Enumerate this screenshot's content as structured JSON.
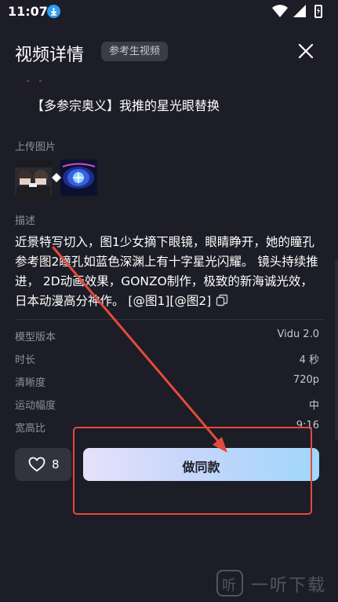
{
  "status_bar": {
    "time": "11:07"
  },
  "header": {
    "title": "视频详情",
    "tag": "参考生视频"
  },
  "content": {
    "partial_top": "-  -",
    "prompt_title": "【多参宗奥义】我推的星光眼替换",
    "upload_label": "上传图片",
    "desc_label": "描述",
    "description": "近景特写切入，图1少女摘下眼镜，眼睛睁开，她的瞳孔参考图2瞳孔如蓝色深渊上有十字星光闪耀。 镜头持续推进， 2D动画效果，GONZO制作，极致的新海诚光效，日本动漫高分神作。 [@图1][@图2]"
  },
  "details": [
    {
      "key": "模型版本",
      "value": "Vidu 2.0"
    },
    {
      "key": "时长",
      "value": "4 秒"
    },
    {
      "key": "清晰度",
      "value": "720p"
    },
    {
      "key": "运动幅度",
      "value": "中"
    },
    {
      "key": "宽高比",
      "value": "9:16"
    }
  ],
  "actions": {
    "like_count": "8",
    "same_button": "做同款"
  },
  "watermark": {
    "text": "一听下载",
    "logo": "听"
  },
  "colors": {
    "annotation": "#e54a3b",
    "background": "#1c1d26"
  }
}
